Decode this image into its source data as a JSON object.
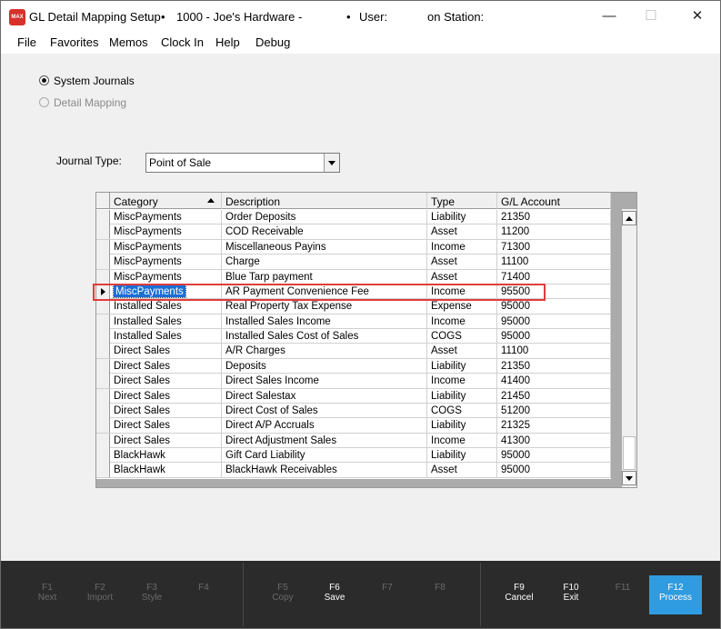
{
  "window": {
    "app_icon_text": "MAX",
    "title_app": "GL Detail Mapping Setup",
    "title_store": "1000 - Joe's Hardware -",
    "title_user": "User:",
    "title_station": "on Station:",
    "bullet": "•",
    "minimize": "—",
    "maximize": "☐",
    "close": "✕"
  },
  "menu": [
    "File",
    "Favorites",
    "Memos",
    "Clock In",
    "Help",
    "Debug"
  ],
  "options": {
    "system_journals": "System Journals",
    "detail_mapping": "Detail Mapping"
  },
  "journal_type": {
    "label": "Journal Type:",
    "value": "Point of Sale"
  },
  "grid": {
    "columns": [
      "Category",
      "Description",
      "Type",
      "G/L Account"
    ],
    "rows": [
      [
        "MiscPayments",
        "Order Deposits",
        "Liability",
        "21350"
      ],
      [
        "MiscPayments",
        "COD Receivable",
        "Asset",
        "11200"
      ],
      [
        "MiscPayments",
        "Miscellaneous Payins",
        "Income",
        "71300"
      ],
      [
        "MiscPayments",
        "Charge",
        "Asset",
        "11100"
      ],
      [
        "MiscPayments",
        "Blue Tarp payment",
        "Asset",
        "71400"
      ],
      [
        "MiscPayments",
        "AR Payment Convenience Fee",
        "Income",
        "95500"
      ],
      [
        "Installed Sales",
        "Real Property Tax Expense",
        "Expense",
        "95000"
      ],
      [
        "Installed Sales",
        "Installed Sales Income",
        "Income",
        "95000"
      ],
      [
        "Installed Sales",
        "Installed Sales Cost of Sales",
        "COGS",
        "95000"
      ],
      [
        "Direct Sales",
        "A/R Charges",
        "Asset",
        "11100"
      ],
      [
        "Direct Sales",
        "Deposits",
        "Liability",
        "21350"
      ],
      [
        "Direct Sales",
        "Direct Sales Income",
        "Income",
        "41400"
      ],
      [
        "Direct Sales",
        "Direct Salestax",
        "Liability",
        "21450"
      ],
      [
        "Direct Sales",
        "Direct Cost of Sales",
        "COGS",
        "51200"
      ],
      [
        "Direct Sales",
        "Direct A/P Accruals",
        "Liability",
        "21325"
      ],
      [
        "Direct Sales",
        "Direct Adjustment Sales",
        "Income",
        "41300"
      ],
      [
        "BlackHawk",
        "Gift Card Liability",
        "Liability",
        "95000"
      ],
      [
        "BlackHawk",
        "BlackHawk Receivables",
        "Asset",
        "95000"
      ]
    ]
  },
  "fkeys": [
    {
      "key": "F1",
      "label": "Next"
    },
    {
      "key": "F2",
      "label": "Import"
    },
    {
      "key": "F3",
      "label": "Style"
    },
    {
      "key": "F4",
      "label": ""
    },
    {
      "key": "F5",
      "label": "Copy"
    },
    {
      "key": "F6",
      "label": "Save"
    },
    {
      "key": "F7",
      "label": ""
    },
    {
      "key": "F8",
      "label": ""
    },
    {
      "key": "F9",
      "label": "Cancel"
    },
    {
      "key": "F10",
      "label": "Exit"
    },
    {
      "key": "F11",
      "label": ""
    },
    {
      "key": "F12",
      "label": "Process"
    }
  ]
}
